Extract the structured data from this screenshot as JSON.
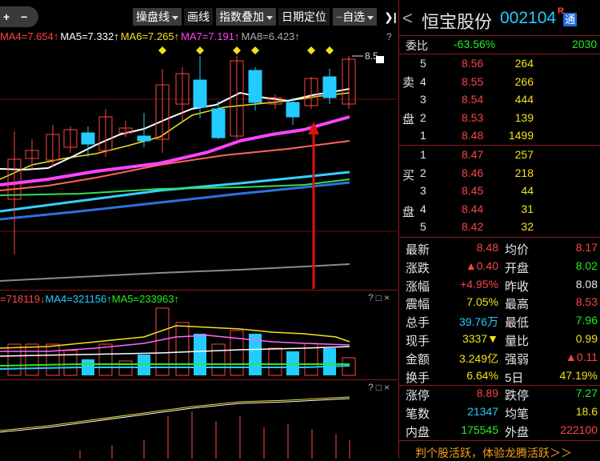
{
  "toolbar": {
    "plus": "+",
    "minus": "−",
    "drawing_tools": "操盘线",
    "draw_line": "画线",
    "indicator_overlay": "指数叠加",
    "date_locate": "日期定位",
    "self_select": "自选",
    "expand": "❯|"
  },
  "ma_line": [
    {
      "text": "MA4=7.654↑",
      "color": "#ff4444"
    },
    {
      "text": "MA5=7.332↑",
      "color": "#ffffff"
    },
    {
      "text": "MA6=7.265↑",
      "color": "#f2e21a"
    },
    {
      "text": "MA7=7.191↑",
      "color": "#ff44ff"
    },
    {
      "text": "MA8=6.423↑",
      "color": "#aaaaaa"
    }
  ],
  "panel_q": "?",
  "price_label": "8.5",
  "volume_line": [
    {
      "text": "=718119↓",
      "color": "#ff4444"
    },
    {
      "text": "MA4=321156↑",
      "color": "#22ccff"
    },
    {
      "text": "MA5=233963↑",
      "color": "#22ee22"
    }
  ],
  "panel_btns": {
    "q": "?",
    "box": "□",
    "close": "×"
  },
  "stock": {
    "name": "恒宝股份",
    "code": "002104",
    "badge_r": "R",
    "badge_tong": "通",
    "back": "<"
  },
  "weibi": {
    "label": "委比",
    "value": "-63.56%",
    "diff": "2030"
  },
  "sell": {
    "label_1": "卖",
    "label_2": "盘",
    "levels": [
      {
        "n": "5",
        "price": "8.56",
        "vol": "264"
      },
      {
        "n": "4",
        "price": "8.55",
        "vol": "266"
      },
      {
        "n": "3",
        "price": "8.54",
        "vol": "444"
      },
      {
        "n": "2",
        "price": "8.53",
        "vol": "139"
      },
      {
        "n": "1",
        "price": "8.48",
        "vol": "1499"
      }
    ]
  },
  "buy": {
    "label_1": "买",
    "label_2": "盘",
    "levels": [
      {
        "n": "1",
        "price": "8.47",
        "vol": "257"
      },
      {
        "n": "2",
        "price": "8.46",
        "vol": "218"
      },
      {
        "n": "3",
        "price": "8.45",
        "vol": "44"
      },
      {
        "n": "4",
        "price": "8.44",
        "vol": "31"
      },
      {
        "n": "5",
        "price": "8.42",
        "vol": "32"
      }
    ]
  },
  "stats": [
    {
      "l1": "最新",
      "v1": "8.48",
      "c1": "#ff4444",
      "l2": "均价",
      "v2": "8.17",
      "c2": "#ff4444"
    },
    {
      "l1": "涨跌",
      "v1": "▲0.40",
      "c1": "#ff4444",
      "l2": "开盘",
      "v2": "8.02",
      "c2": "#22ee22"
    },
    {
      "l1": "涨幅",
      "v1": "+4.95%",
      "c1": "#ff4444",
      "l2": "昨收",
      "v2": "8.08",
      "c2": "#e6e6e6"
    },
    {
      "l1": "震幅",
      "v1": "7.05%",
      "c1": "#f2e21a",
      "l2": "最高",
      "v2": "8.53",
      "c2": "#ff4444"
    },
    {
      "l1": "总手",
      "v1": "39.76万",
      "c1": "#22ccff",
      "l2": "最低",
      "v2": "7.96",
      "c2": "#22ee22"
    },
    {
      "l1": "现手",
      "v1": "3337▼",
      "c1": "#f2e21a",
      "l2": "量比",
      "v2": "0.99",
      "c2": "#f2e21a"
    },
    {
      "l1": "金额",
      "v1": "3.249亿",
      "c1": "#f2e21a",
      "l2": "强弱",
      "v2": "▲0.11",
      "c2": "#ff4444"
    },
    {
      "l1": "换手",
      "v1": "6.64%",
      "c1": "#f2e21a",
      "l2": "5日",
      "v2": "47.19%",
      "c2": "#f2e21a"
    },
    {
      "l1": "涨停",
      "v1": "8.89",
      "c1": "#ff4444",
      "l2": "跌停",
      "v2": "7.27",
      "c2": "#22ee22"
    },
    {
      "l1": "笔数",
      "v1": "21347",
      "c1": "#22ccff",
      "l2": "均笔",
      "v2": "18.6",
      "c2": "#f2e21a"
    },
    {
      "l1": "内盘",
      "v1": "175545",
      "c1": "#22ee22",
      "l2": "外盘",
      "v2": "222100",
      "c2": "#ff4444"
    }
  ],
  "footer_ad": "判个股活跃，体验龙腾活跃＞＞"
}
